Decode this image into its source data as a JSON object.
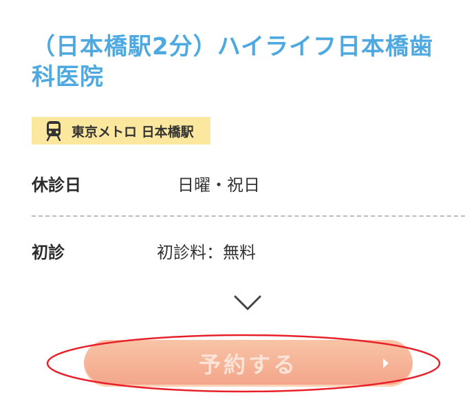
{
  "clinic": {
    "name": "（日本橋駅2分）ハイライフ日本橋歯科医院"
  },
  "station": {
    "icon": "train-icon",
    "label": "東京メトロ 日本橋駅"
  },
  "info": {
    "closed_days_label": "休診日",
    "closed_days_value": "日曜・祝日",
    "first_visit_label": "初診",
    "first_visit_value": "初診料：無料"
  },
  "expand": {
    "icon": "chevron-down-icon"
  },
  "reserve": {
    "label": "予約する",
    "icon": "chevron-right-icon"
  },
  "colors": {
    "title": "#4ea9e0",
    "badge_bg": "#fbe79e",
    "button": "#f3a489",
    "annotation": "#e8202a"
  }
}
